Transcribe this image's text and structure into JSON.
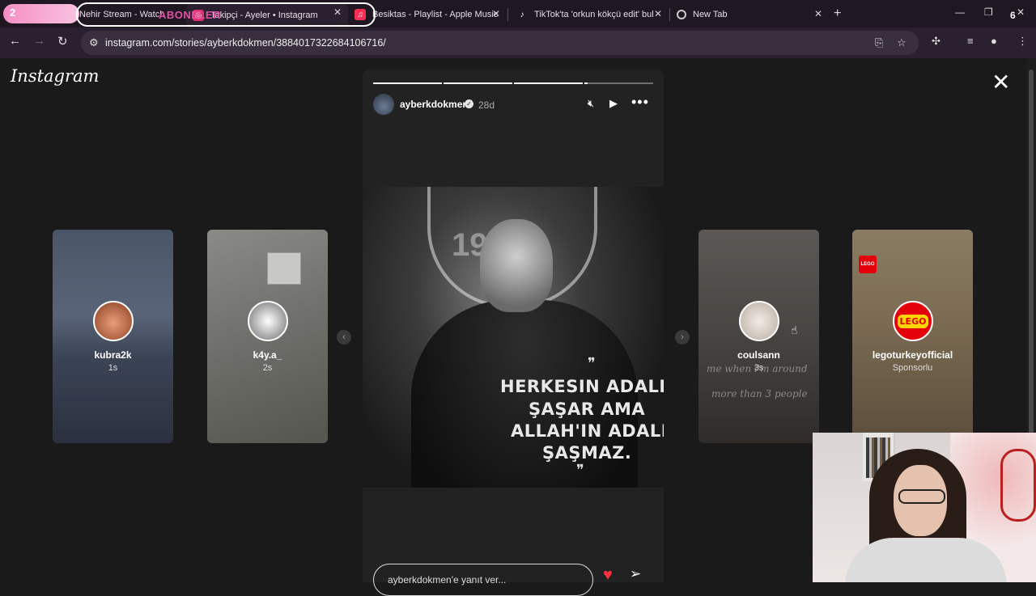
{
  "browser": {
    "overlay_left_number": "2",
    "overlay_label": "ABONELER",
    "overlay_right_number": "6",
    "tabs": [
      {
        "title": "Nehir Stream - Watch",
        "active": false
      },
      {
        "title": "Takipçi - Ayeler • Instagram",
        "active": true
      },
      {
        "title": "Besiktas - Playlist - Apple Music",
        "active": false
      },
      {
        "title": "TikTok'ta 'orkun kökçü edit' bul",
        "active": false
      },
      {
        "title": "New Tab",
        "active": false
      }
    ],
    "url": "instagram.com/stories/ayberkdokmen/3884017322684106716/"
  },
  "instagram": {
    "logo": "Instagram",
    "story": {
      "username": "ayberkdokmen",
      "age": "28d",
      "progress_segments": [
        1,
        1,
        1,
        0.05
      ],
      "quote_lines": [
        "HERKESIN ADALETI",
        "ŞAŞAR AMA",
        "ALLAH'IN ADALETI",
        "ŞAŞMAZ."
      ],
      "shield_text": "19",
      "reply_placeholder": "ayberkdokmen'e yanıt ver..."
    },
    "side_stories": [
      {
        "name": "kubra2k",
        "time": "1s"
      },
      {
        "name": "k4y.a_",
        "time": "2s"
      },
      {
        "name": "coulsann",
        "time": "3s",
        "overlay_lines": [
          "me when i'm around",
          "more than 3 people"
        ]
      },
      {
        "name": "legoturkeyofficial",
        "time": "Sponsorlu",
        "badge": "LEGO",
        "small_badge": "LEGO"
      }
    ]
  }
}
